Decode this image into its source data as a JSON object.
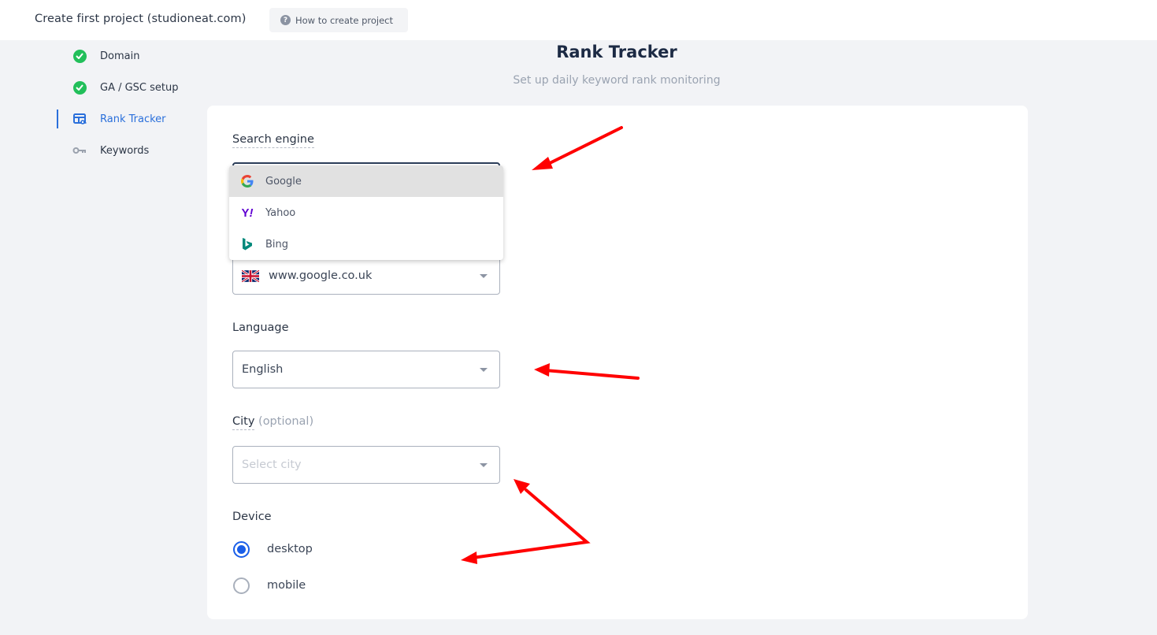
{
  "topbar": {
    "title": "Create first project (studioneat.com)",
    "help_button": {
      "label": "How to create project",
      "icon": "question-circle-icon"
    }
  },
  "sidebar": {
    "items": [
      {
        "label": "Domain",
        "icon": "check-circle-icon",
        "status": "completed"
      },
      {
        "label": "GA / GSC setup",
        "icon": "check-circle-icon",
        "status": "completed"
      },
      {
        "label": "Rank Tracker",
        "icon": "rank-tracker-icon",
        "status": "active"
      },
      {
        "label": "Keywords",
        "icon": "key-icon",
        "status": "pending"
      }
    ]
  },
  "main": {
    "title": "Rank Tracker",
    "subtitle": "Set up daily keyword rank monitoring",
    "search_engine": {
      "label": "Search engine",
      "options": [
        {
          "label": "Google",
          "icon": "google-icon",
          "highlighted": true
        },
        {
          "label": "Yahoo",
          "icon": "yahoo-icon",
          "highlighted": false
        },
        {
          "label": "Bing",
          "icon": "bing-icon",
          "highlighted": false
        }
      ]
    },
    "location": {
      "value": "www.google.co.uk",
      "icon": "uk-flag-icon"
    },
    "language": {
      "label": "Language",
      "value": "English"
    },
    "city": {
      "label": "City",
      "optional_note": "(optional)",
      "placeholder": "Select city"
    },
    "device": {
      "label": "Device",
      "options": [
        {
          "label": "desktop",
          "checked": true
        },
        {
          "label": "mobile",
          "checked": false
        }
      ]
    }
  },
  "annotations": {
    "arrow_color": "#ff0000"
  },
  "colors": {
    "accent": "#2a6fdb",
    "success": "#22bf5a",
    "radio": "#1a5ee8"
  }
}
